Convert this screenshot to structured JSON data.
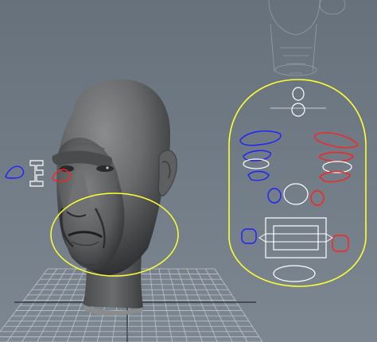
{
  "viewport": {
    "background_top": "#67717b",
    "background_bottom": "#7c8792",
    "grid_color": "#c9ced3",
    "grid_axis_color": "#2c2f33"
  },
  "head_model": {
    "skin_color": "#6a6b6d",
    "shadow_color": "#232426"
  },
  "rig_controls": {
    "selected_curve_color": "#ffff33",
    "left_side_color": "#2020ff",
    "right_side_color": "#ff2020",
    "center_color": "#ffffff",
    "ghost_curve_color": "#a7adb3"
  }
}
